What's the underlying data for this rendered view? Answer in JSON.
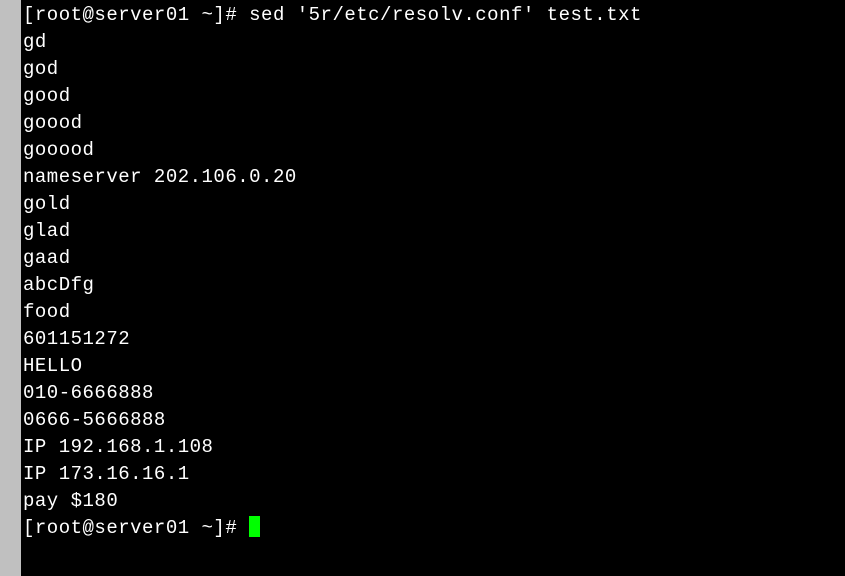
{
  "terminal": {
    "prompt1": "[root@server01 ~]# ",
    "command": "sed '5r/etc/resolv.conf' test.txt",
    "output": [
      "gd",
      "god",
      "good",
      "goood",
      "gooood",
      "",
      "nameserver 202.106.0.20",
      "gold",
      "glad",
      "gaad",
      "abcDfg",
      "food",
      "601151272",
      "HELLO",
      "010-6666888",
      "0666-5666888",
      "IP 192.168.1.108",
      "IP 173.16.16.1",
      "pay $180"
    ],
    "prompt2": "[root@server01 ~]# "
  }
}
